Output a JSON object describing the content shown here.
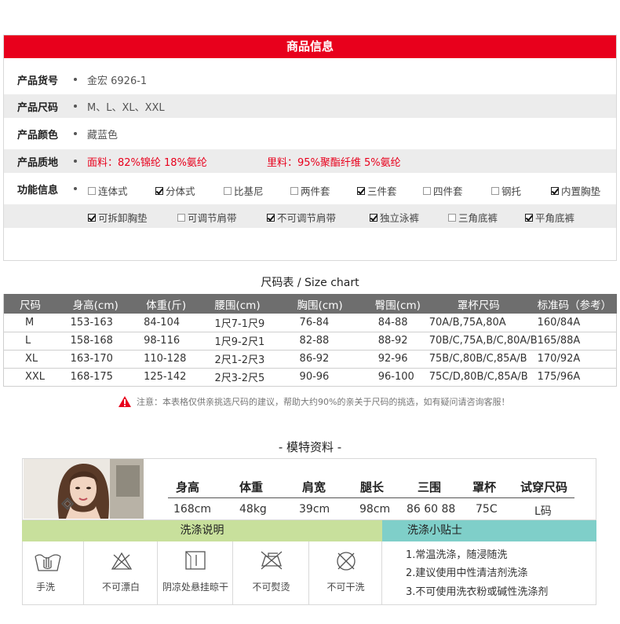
{
  "info": {
    "header": "商品信息",
    "rows": {
      "sku": {
        "label": "产品货号",
        "value": "金宏 6926-1"
      },
      "size": {
        "label": "产品尺码",
        "value": "M、L、XL、XXL"
      },
      "color": {
        "label": "产品颜色",
        "value": "藏蓝色"
      },
      "material": {
        "label": "产品质地",
        "outer": "面料：82%锦纶  18%氨纶",
        "lining": "里料：95%聚酯纤维  5%氨纶"
      },
      "feature": {
        "label": "功能信息"
      }
    },
    "features": [
      {
        "label": "连体式",
        "checked": false
      },
      {
        "label": "分体式",
        "checked": true
      },
      {
        "label": "比基尼",
        "checked": false
      },
      {
        "label": "两件套",
        "checked": false
      },
      {
        "label": "三件套",
        "checked": true
      },
      {
        "label": "四件套",
        "checked": false
      },
      {
        "label": "钢托",
        "checked": false
      },
      {
        "label": "内置胸垫",
        "checked": true
      },
      {
        "label": "可拆卸胸垫",
        "checked": true
      },
      {
        "label": "可调节肩带",
        "checked": false
      },
      {
        "label": "不可调节肩带",
        "checked": true
      },
      {
        "label": "独立泳裤",
        "checked": true
      },
      {
        "label": "三角底裤",
        "checked": false
      },
      {
        "label": "平角底裤",
        "checked": true
      }
    ]
  },
  "size_chart": {
    "title": "尺码表 / Size chart",
    "headers": [
      "尺码",
      "身高(cm)",
      "体重(斤)",
      "腰围(cm)",
      "胸围(cm)",
      "臀围(cm)",
      "罩杯尺码",
      "标准码（参考）"
    ],
    "rows": [
      [
        "M",
        "153-163",
        "84-104",
        "1尺7-1尺9",
        "76-84",
        "84-88",
        "70A/B,75A,80A",
        "160/84A"
      ],
      [
        "L",
        "158-168",
        "98-116",
        "1尺9-2尺1",
        "82-88",
        "88-92",
        "70B/C,75A,B/C,80A/B",
        "165/88A"
      ],
      [
        "XL",
        "163-170",
        "110-128",
        "2尺1-2尺3",
        "86-92",
        "92-96",
        "75B/C,80B/C,85A/B",
        "170/92A"
      ],
      [
        "XXL",
        "168-175",
        "125-142",
        "2尺3-2尺5",
        "90-96",
        "96-100",
        "75C/D,80B/C,85A/B",
        "175/96A"
      ]
    ],
    "note": "注意：本表格仅供亲挑选尺码的建议，帮助大约90%的亲关于尺码的挑选，如有疑问请咨询客服！"
  },
  "model": {
    "title": "- 模特资料 -",
    "headers": [
      "身高",
      "体重",
      "肩宽",
      "腿长",
      "三围",
      "罩杯",
      "试穿尺码"
    ],
    "values": [
      "168cm",
      "48kg",
      "39cm",
      "98cm",
      "86 60 88",
      "75C",
      "L码"
    ]
  },
  "wash": {
    "left_title": "洗涤说明",
    "right_title": "洗涤小贴士",
    "items": [
      {
        "label": "手洗",
        "icon": "hand-wash-icon"
      },
      {
        "label": "不可漂白",
        "icon": "no-bleach-icon"
      },
      {
        "label": "阴凉处悬挂晾干",
        "icon": "shade-hang-dry-icon"
      },
      {
        "label": "不可熨烫",
        "icon": "no-iron-icon"
      },
      {
        "label": "不可干洗",
        "icon": "no-dry-clean-icon"
      }
    ],
    "tips": [
      "1.常温洗涤，随浸随洗",
      "2.建议使用中性清洁剂洗涤",
      "3.不可使用洗衣粉或碱性洗涤剂"
    ]
  },
  "colors": {
    "accent": "#e8001c",
    "table_header": "#6e6e6e",
    "wash_green": "#c8e09c",
    "wash_teal": "#7fcfc9"
  }
}
